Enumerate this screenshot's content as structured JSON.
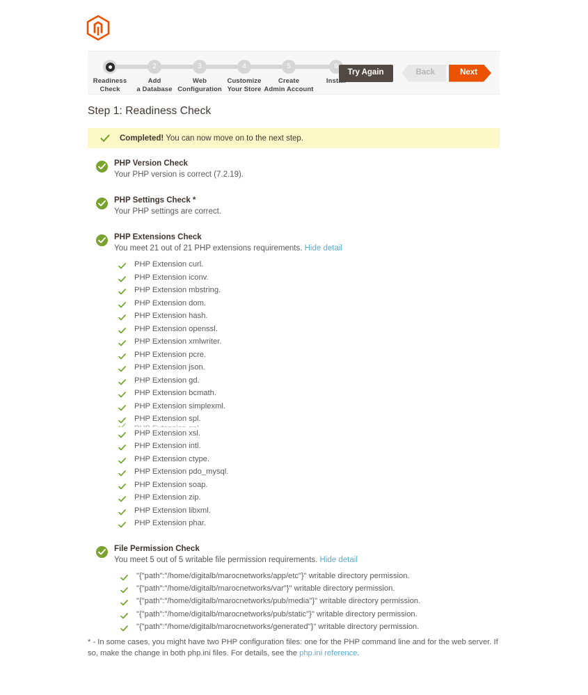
{
  "brand": {
    "logo_icon": "magento-logo-icon",
    "accent": "#eb5202"
  },
  "stepper": {
    "steps": [
      {
        "number": "1",
        "label": "Readiness\nCheck",
        "state": "active"
      },
      {
        "number": "2",
        "label": "Add\na Database",
        "state": "upcoming"
      },
      {
        "number": "3",
        "label": "Web\nConfiguration",
        "state": "upcoming"
      },
      {
        "number": "4",
        "label": "Customize\nYour Store",
        "state": "upcoming"
      },
      {
        "number": "5",
        "label": "Create\nAdmin Account",
        "state": "upcoming"
      },
      {
        "number": "6",
        "label": "Install",
        "state": "upcoming"
      }
    ],
    "buttons": {
      "try_again": "Try Again",
      "back": "Back",
      "next": "Next"
    }
  },
  "page": {
    "title": "Step 1: Readiness Check"
  },
  "banner": {
    "icon": "check-icon",
    "strong": "Completed!",
    "text": " You can now move on to the next step."
  },
  "checks": [
    {
      "name": "php-version-check",
      "title": "PHP Version Check",
      "subtitle": "Your PHP version is correct (7.2.19)."
    },
    {
      "name": "php-settings-check",
      "title": "PHP Settings Check *",
      "subtitle": "Your PHP settings are correct."
    },
    {
      "name": "php-extensions-check",
      "title": "PHP Extensions Check",
      "subtitle": "You meet 21 out of 21 PHP extensions requirements.",
      "toggle": "Hide detail",
      "items": [
        "PHP Extension curl.",
        "PHP Extension iconv.",
        "PHP Extension mbstring.",
        "PHP Extension dom.",
        "PHP Extension hash.",
        "PHP Extension openssl.",
        "PHP Extension xmlwriter.",
        "PHP Extension pcre.",
        "PHP Extension json.",
        "PHP Extension gd.",
        "PHP Extension bcmath.",
        "PHP Extension simplexml.",
        "PHP Extension spl.",
        "PHP Extension spl.",
        "PHP Extension xsl.",
        "PHP Extension intl.",
        "PHP Extension ctype.",
        "PHP Extension pdo_mysql.",
        "PHP Extension soap.",
        "PHP Extension zip.",
        "PHP Extension libxml.",
        "PHP Extension phar."
      ],
      "artifact_index": 13
    },
    {
      "name": "file-permission-check",
      "title": "File Permission Check",
      "subtitle": "You meet 5 out of 5 writable file permission requirements.",
      "toggle": "Hide detail",
      "items": [
        "\"{\"path\":\"/home/digitalb/marocnetworks/app/etc\"}\" writable directory permission.",
        "\"{\"path\":\"/home/digitalb/marocnetworks/var\"}\" writable directory permission.",
        "\"{\"path\":\"/home/digitalb/marocnetworks/pub/media\"}\" writable directory permission.",
        "\"{\"path\":\"/home/digitalb/marocnetworks/pub/static\"}\" writable directory permission.",
        "\"{\"path\":\"/home/digitalb/marocnetworks/generated\"}\" writable directory permission."
      ]
    }
  ],
  "footnote": {
    "text_before": "* - In some cases, you might have two PHP configuration files: one for the PHP command line and for the web server. If so, make the change in both php.ini files. For details, see the ",
    "link": "php.ini reference",
    "text_after": "."
  }
}
